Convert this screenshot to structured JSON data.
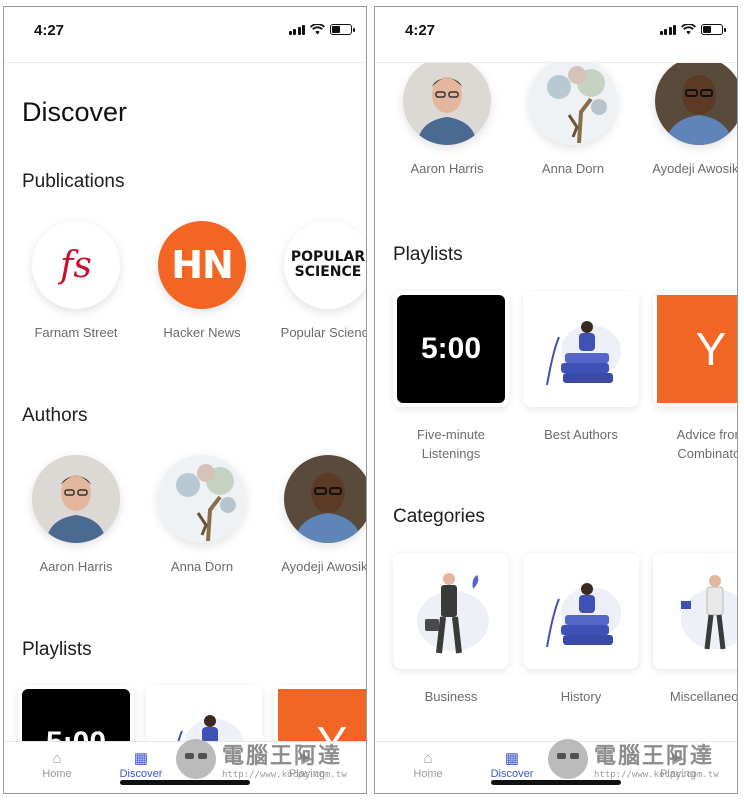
{
  "left": {
    "status": {
      "time": "4:27"
    },
    "title": "Discover",
    "publications": {
      "heading": "Publications",
      "items": [
        {
          "name": "Farnam Street",
          "logo": "fs"
        },
        {
          "name": "Hacker News",
          "logo": "HN"
        },
        {
          "name": "Popular Science",
          "logo_lines": [
            "POPULAR",
            "SCIENCE"
          ]
        }
      ]
    },
    "authors": {
      "heading": "Authors",
      "items": [
        {
          "name": "Aaron Harris"
        },
        {
          "name": "Anna Dorn"
        },
        {
          "name": "Ayodeji Awosika"
        }
      ]
    },
    "playlists": {
      "heading": "Playlists",
      "items": [
        {
          "tile": "5:00"
        },
        {
          "tile": ""
        },
        {
          "tile": "Y"
        }
      ]
    },
    "tabs": [
      {
        "label": "Home"
      },
      {
        "label": "Discover"
      },
      {
        "label": "Playing"
      }
    ]
  },
  "right": {
    "status": {
      "time": "4:27"
    },
    "authors": {
      "items": [
        {
          "name": "Aaron Harris"
        },
        {
          "name": "Anna Dorn"
        },
        {
          "name": "Ayodeji Awosika"
        }
      ]
    },
    "playlists": {
      "heading": "Playlists",
      "items": [
        {
          "name_line1": "Five-minute",
          "name_line2": "Listenings",
          "tile": "5:00"
        },
        {
          "name_line1": "Best Authors",
          "name_line2": ""
        },
        {
          "name_line1": "Advice from",
          "name_line2": "Combinator",
          "tile": "Y"
        }
      ]
    },
    "categories": {
      "heading": "Categories",
      "items": [
        {
          "name": "Business"
        },
        {
          "name": "History"
        },
        {
          "name": "Miscellaneous"
        }
      ]
    },
    "tabs": [
      {
        "label": "Home"
      },
      {
        "label": "Discover"
      },
      {
        "label": "Playing"
      }
    ]
  },
  "watermark": {
    "title": "電腦王阿達",
    "url": "http://www.kocpc.com.tw"
  },
  "colors": {
    "accent": "#3c54c9",
    "hn_orange": "#f26522",
    "fs_red": "#c8102e"
  },
  "icons": {
    "home": "home-icon",
    "discover": "grid-icon",
    "playing": "play-icon"
  }
}
